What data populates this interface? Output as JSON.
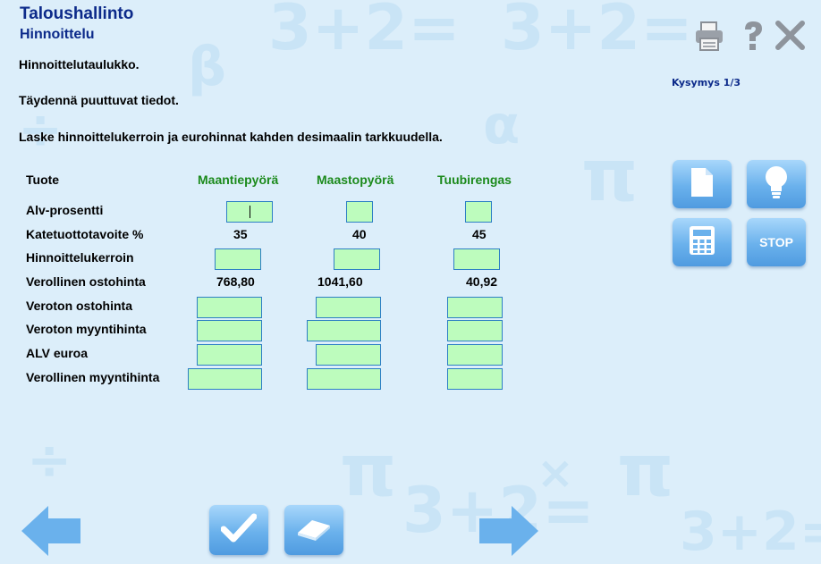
{
  "header": {
    "title": "Taloushallinto",
    "subtitle": "Hinnoittelu"
  },
  "instructions": {
    "line1": "Hinnoittelutaulukko.",
    "line2": "Täydennä puuttuvat tiedot.",
    "line3": "Laske hinnoittelukerroin ja eurohinnat kahden desimaalin tarkkuudella."
  },
  "question_counter": "Kysymys 1/3",
  "table": {
    "corner_label": "Tuote",
    "products": [
      "Maantiepyörä",
      "Maastopyörä",
      "Tuubirengas"
    ],
    "rows": [
      {
        "label": "Alv-prosentti",
        "values": [
          "",
          "",
          ""
        ]
      },
      {
        "label": "Katetuottotavoite %",
        "values": [
          "35",
          "40",
          "45"
        ]
      },
      {
        "label": "Hinnoittelukerroin",
        "values": [
          "",
          "",
          ""
        ]
      },
      {
        "label": "Verollinen ostohinta",
        "values": [
          "768,80",
          "1041,60",
          "40,92"
        ]
      },
      {
        "label": "Veroton ostohinta",
        "values": [
          "",
          "",
          ""
        ]
      },
      {
        "label": "Veroton myyntihinta",
        "values": [
          "",
          "",
          ""
        ]
      },
      {
        "label": "ALV euroa",
        "values": [
          "",
          "",
          ""
        ]
      },
      {
        "label": "Verollinen myyntihinta",
        "values": [
          "",
          "",
          ""
        ]
      }
    ]
  },
  "tools": {
    "stop_label": "STOP"
  },
  "icons": {
    "print": "printer-icon",
    "help": "question-mark-icon",
    "close": "close-icon",
    "document": "document-icon",
    "hint": "lightbulb-icon",
    "calculator": "calculator-icon",
    "check": "checkmark-icon",
    "eraser": "eraser-icon",
    "back": "arrow-left-icon",
    "forward": "arrow-right-icon"
  },
  "colors": {
    "title": "#0c2a8a",
    "product_header": "#1c8a1c",
    "input_fill": "#bdfcbd",
    "input_border": "#2d7fc4",
    "button_blue": "#6ab1ec",
    "background": "#dceefa"
  }
}
